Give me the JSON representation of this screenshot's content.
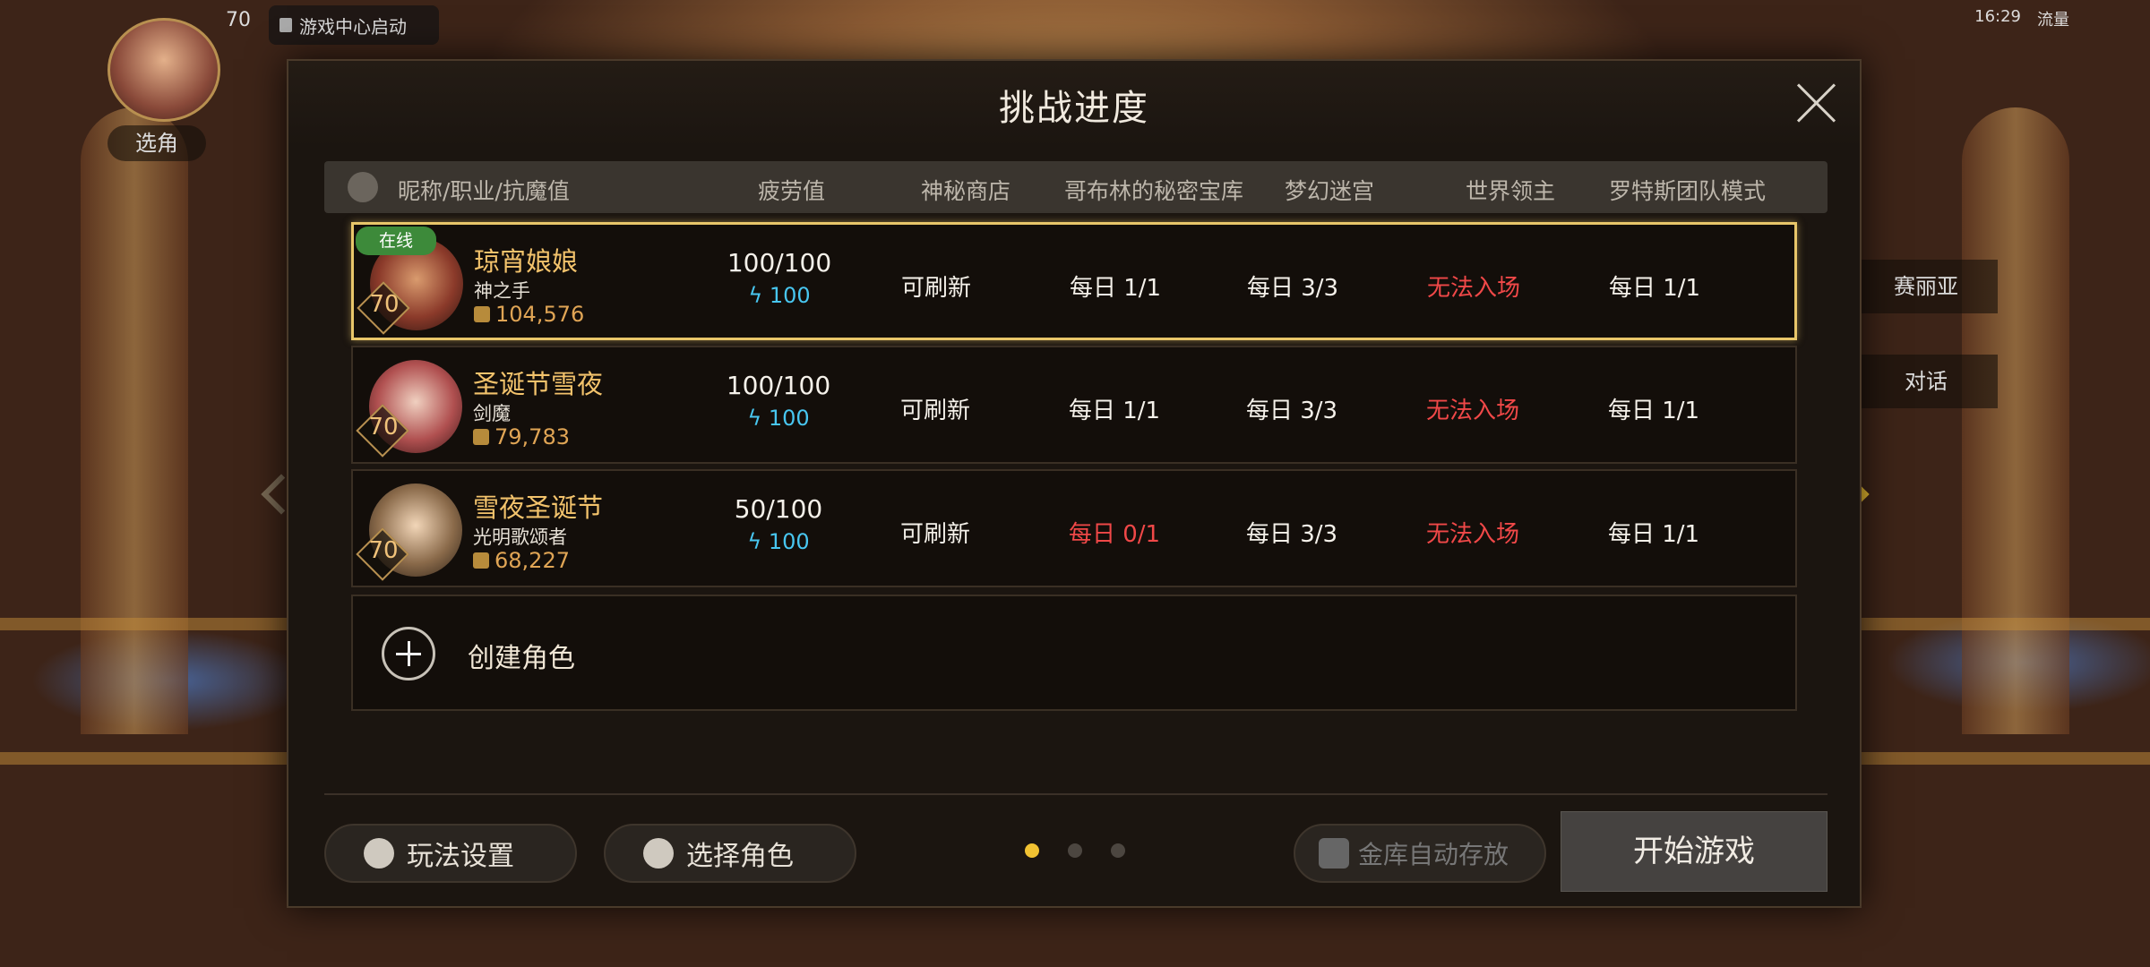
{
  "game_hud": {
    "top_level": "70",
    "notify_label": "游戏中心启动",
    "role_label": "选角",
    "right_menu_1": "赛丽亚",
    "right_menu_2": "对话",
    "status_time": "16:29",
    "status_extra": "流量"
  },
  "dialog": {
    "title": "挑战进度",
    "headers": {
      "name": "昵称/职业/抗魔值",
      "fatigue": "疲劳值",
      "shop": "神秘商店",
      "goblin": "哥布林的秘密宝库",
      "maze": "梦幻迷宫",
      "world_boss": "世界领主",
      "lotus": "罗特斯团队模式"
    },
    "characters": [
      {
        "online": "在线",
        "level": "70",
        "name": "琼宵娘娘",
        "class": "神之手",
        "power": "104,576",
        "fatigue": "100/100",
        "fatigue_bonus": "100",
        "shop": "可刷新",
        "goblin": "每日 1/1",
        "maze": "每日 3/3",
        "world_boss": "无法入场",
        "lotus": "每日 1/1"
      },
      {
        "online": "",
        "level": "70",
        "name": "圣诞节雪夜",
        "class": "剑魔",
        "power": "79,783",
        "fatigue": "100/100",
        "fatigue_bonus": "100",
        "shop": "可刷新",
        "goblin": "每日 1/1",
        "maze": "每日 3/3",
        "world_boss": "无法入场",
        "lotus": "每日 1/1"
      },
      {
        "online": "",
        "level": "70",
        "name": "雪夜圣诞节",
        "class": "光明歌颂者",
        "power": "68,227",
        "fatigue": "50/100",
        "fatigue_bonus": "100",
        "shop": "可刷新",
        "goblin": "每日 0/1",
        "maze": "每日 3/3",
        "world_boss": "无法入场",
        "lotus": "每日 1/1"
      }
    ],
    "create_label": "创建角色",
    "buttons": {
      "settings": "玩法设置",
      "select_role": "选择角色",
      "vault": "金库自动存放",
      "start": "开始游戏"
    },
    "pagination": {
      "current": 1,
      "total": 3
    }
  },
  "colors": {
    "accent_gold": "#f3c36c",
    "warning_red": "#f04848",
    "fatigue_blue": "#48c6f0",
    "online_green": "#3d8a3a"
  }
}
